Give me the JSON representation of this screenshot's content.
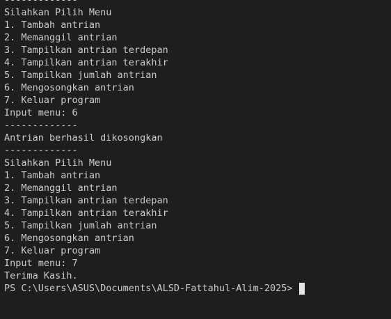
{
  "terminal": {
    "lines": [
      "-------------",
      "Silahkan Pilih Menu",
      "1. Tambah antrian",
      "2. Memanggil antrian",
      "3. Tampilkan antrian terdepan",
      "4. Tampilkan antrian terakhir",
      "5. Tampilkan jumlah antrian",
      "6. Mengosongkan antrian",
      "7. Keluar program",
      "Input menu: 6",
      "-------------",
      "Antrian berhasil dikosongkan",
      "-------------",
      "Silahkan Pilih Menu",
      "1. Tambah antrian",
      "2. Memanggil antrian",
      "3. Tampilkan antrian terdepan",
      "4. Tampilkan antrian terakhir",
      "5. Tampilkan jumlah antrian",
      "6. Mengosongkan antrian",
      "7. Keluar program",
      "Input menu: 7",
      "Terima Kasih."
    ],
    "prompt": "PS C:\\Users\\ASUS\\Documents\\ALSD-Fattahul-Alim-2025> "
  }
}
